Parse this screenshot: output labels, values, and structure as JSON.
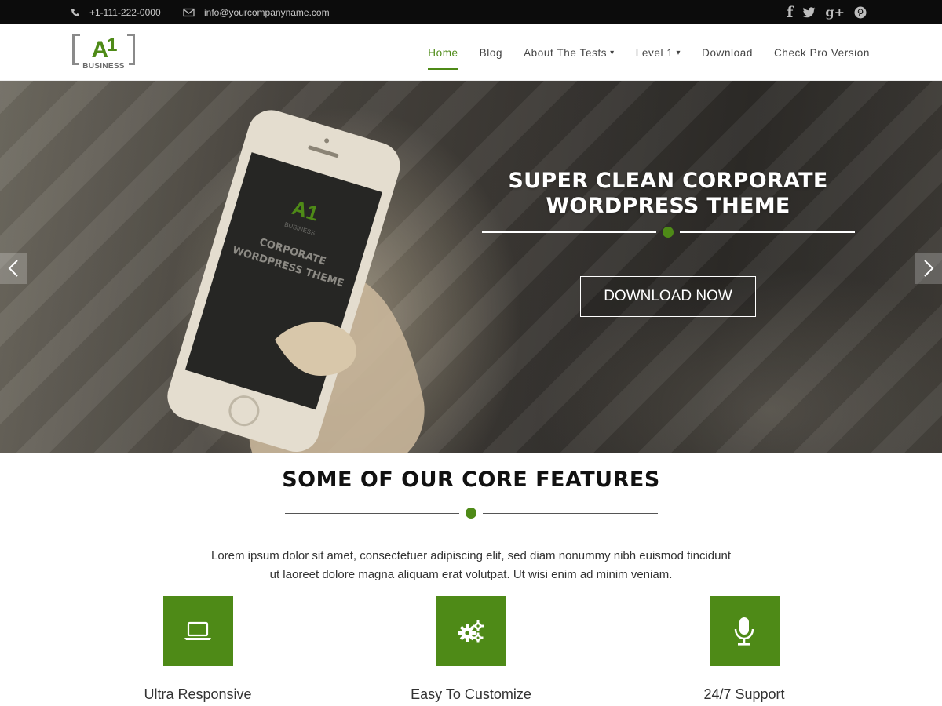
{
  "topbar": {
    "phone": "+1-111-222-0000",
    "email": "info@yourcompanyname.com",
    "social": [
      "facebook-icon",
      "twitter-icon",
      "google-plus-icon",
      "pinterest-icon"
    ]
  },
  "logo": {
    "mark": "A",
    "mark_sup": "1",
    "word": "BUSINESS"
  },
  "nav": {
    "items": [
      {
        "label": "Home",
        "active": true
      },
      {
        "label": "Blog"
      },
      {
        "label": "About The Tests",
        "dropdown": true
      },
      {
        "label": "Level 1",
        "dropdown": true
      },
      {
        "label": "Download"
      },
      {
        "label": "Check Pro Version"
      }
    ]
  },
  "hero": {
    "headline_1": "SUPER CLEAN CORPORATE",
    "headline_2": "WORDPRESS THEME",
    "button": "DOWNLOAD NOW",
    "phone_screen_logo": "A1",
    "phone_screen_brand": "BUSINESS",
    "phone_screen_line1": "CORPORATE",
    "phone_screen_line2": "WORDPRESS THEME"
  },
  "features": {
    "title": "SOME OF OUR CORE FEATURES",
    "desc_line1": "Lorem ipsum dolor sit amet, consectetuer adipiscing elit, sed diam nonummy nibh euismod tincidunt",
    "desc_line2": "ut laoreet dolore magna aliquam erat volutpat. Ut wisi enim ad minim veniam.",
    "items": [
      {
        "label": "Ultra Responsive",
        "icon": "laptop-icon"
      },
      {
        "label": "Easy To Customize",
        "icon": "gears-icon"
      },
      {
        "label": "24/7 Support",
        "icon": "microphone-icon"
      }
    ]
  },
  "colors": {
    "accent": "#4e8a17",
    "topbar": "#0c0c0c"
  }
}
